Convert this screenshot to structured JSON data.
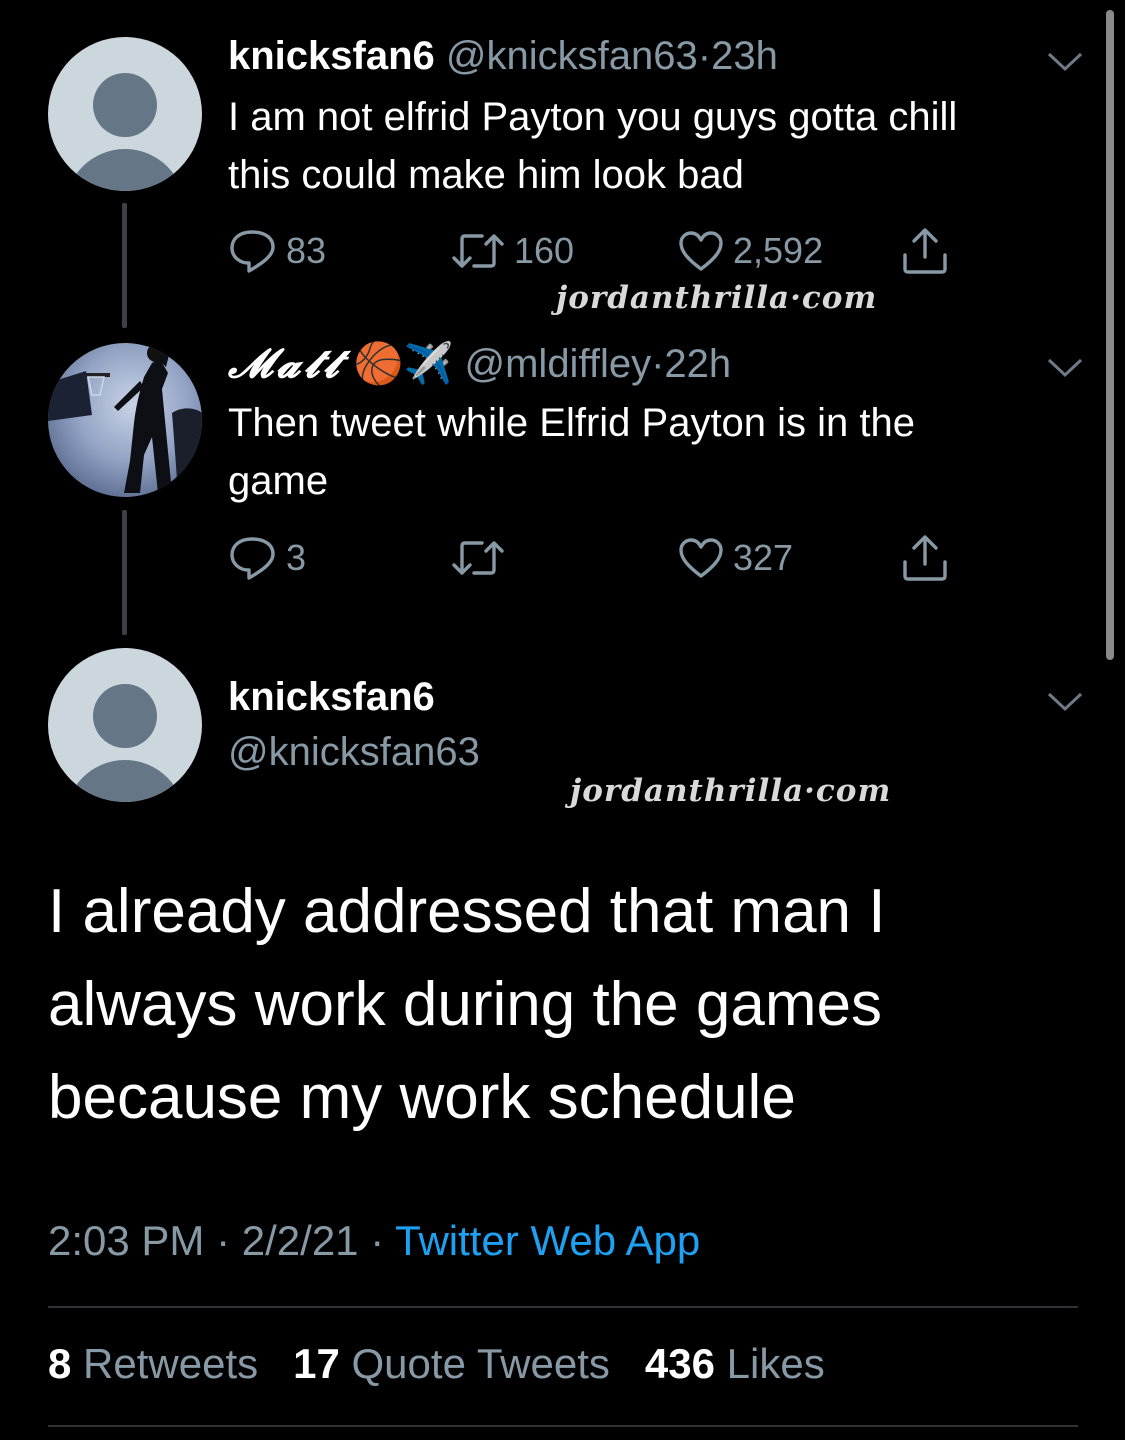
{
  "reply1": {
    "name": "knicksfan6",
    "handle": "@knicksfan63",
    "dot": "·",
    "time": "23h",
    "text_line1": "I am not elfrid Payton you guys gotta chill",
    "text_line2": "this could make him look bad",
    "replies": "83",
    "retweets": "160",
    "likes": "2,592"
  },
  "watermark1": "jordanthrilla·com",
  "reply2": {
    "name": "𝓜𝓪𝓽𝓽",
    "emoji": "🏀✈️",
    "handle": "@mldiffley",
    "dot": "·",
    "time": "22h",
    "text_line1": "Then tweet while Elfrid Payton is in the",
    "text_line2": "game",
    "replies": "3",
    "likes": "327"
  },
  "main": {
    "name": "knicksfan6",
    "handle": "@knicksfan63",
    "watermark": "jordanthrilla·com",
    "text_line1": "I already addressed that man I",
    "text_line2": "always work during the games",
    "text_line3": "because my work schedule",
    "time": "2:03 PM",
    "date": "2/2/21",
    "sep": "·",
    "source": "Twitter Web App",
    "retweets_count": "8",
    "retweets_label": "Retweets",
    "quotes_count": "17",
    "quotes_label": "Quote Tweets",
    "likes_count": "436",
    "likes_label": "Likes"
  },
  "colors": {
    "background": "#000000",
    "secondary_text": "#8899a6",
    "link": "#1da1f2",
    "avatar_bg": "#ccd6dd",
    "avatar_fg": "#657786"
  },
  "icons": [
    "reply-icon",
    "retweet-icon",
    "like-icon",
    "share-icon",
    "chevron-down-icon"
  ]
}
